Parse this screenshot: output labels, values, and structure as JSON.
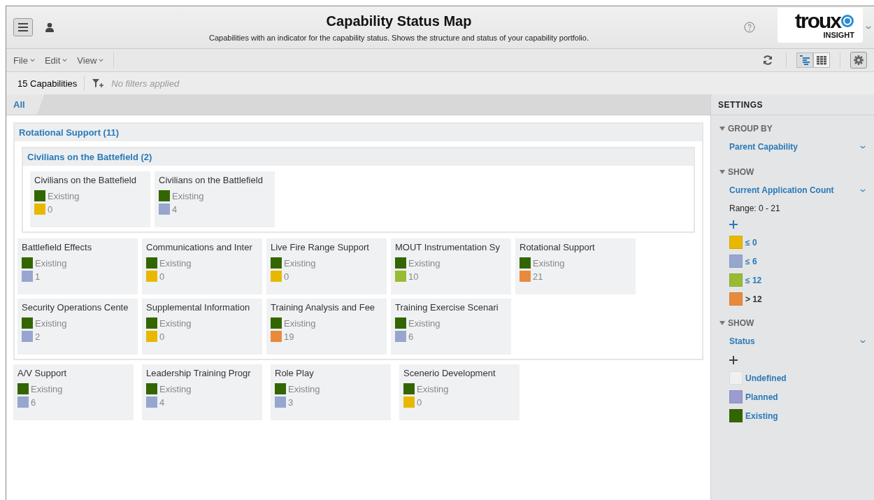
{
  "header": {
    "title": "Capability Status Map",
    "subtitle": "Capabilities with an indicator for the capability status. Shows the structure and status of your capability portfolio.",
    "logo": "troux",
    "logo_sub": "INSIGHT"
  },
  "menus": [
    {
      "label": "File"
    },
    {
      "label": "Edit"
    },
    {
      "label": "View"
    }
  ],
  "view_toggles": [
    {
      "kind": "tree",
      "selected": true
    },
    {
      "kind": "grid",
      "selected": false
    }
  ],
  "filter_bar": {
    "count": "15 Capabilities",
    "filters": "No filters applied"
  },
  "tabs": [
    {
      "label": "All",
      "selected": true
    }
  ],
  "groups": [
    {
      "title": "Rotational Support (11)",
      "subgroups": [
        {
          "title": "Civilians on the Battefield  (2)",
          "cards": [
            {
              "name": "Civilians on the Battefield",
              "status": {
                "label": "Existing",
                "color": "#336600"
              },
              "count": {
                "value": "0",
                "color": "#e8b800"
              }
            },
            {
              "name": "Civilians on the Battlefield",
              "status": {
                "label": "Existing",
                "color": "#336600"
              },
              "count": {
                "value": "4",
                "color": "#97a6cf"
              }
            }
          ]
        }
      ],
      "cards": [
        {
          "name": "Battlefield Effects",
          "status": {
            "label": "Existing",
            "color": "#336600"
          },
          "count": {
            "value": "1",
            "color": "#97a6cf"
          }
        },
        {
          "name": "Communications and Inter",
          "status": {
            "label": "Existing",
            "color": "#336600"
          },
          "count": {
            "value": "0",
            "color": "#e8b800"
          }
        },
        {
          "name": "Live Fire Range Support",
          "status": {
            "label": "Existing",
            "color": "#336600"
          },
          "count": {
            "value": "0",
            "color": "#e8b800"
          }
        },
        {
          "name": "MOUT Instrumentation Sy",
          "status": {
            "label": "Existing",
            "color": "#336600"
          },
          "count": {
            "value": "10",
            "color": "#99bb33"
          }
        },
        {
          "name": "Rotational Support",
          "status": {
            "label": "Existing",
            "color": "#336600"
          },
          "count": {
            "value": "21",
            "color": "#e88a3c"
          }
        },
        {
          "name": "Security Operations Cente",
          "status": {
            "label": "Existing",
            "color": "#336600"
          },
          "count": {
            "value": "2",
            "color": "#97a6cf"
          }
        },
        {
          "name": "Supplemental Information",
          "status": {
            "label": "Existing",
            "color": "#336600"
          },
          "count": {
            "value": "0",
            "color": "#e8b800"
          }
        },
        {
          "name": "Training Analysis and Fee",
          "status": {
            "label": "Existing",
            "color": "#336600"
          },
          "count": {
            "value": "19",
            "color": "#e88a3c"
          }
        },
        {
          "name": "Training Exercise Scenari",
          "status": {
            "label": "Existing",
            "color": "#336600"
          },
          "count": {
            "value": "6",
            "color": "#97a6cf"
          }
        }
      ]
    }
  ],
  "cards": [
    {
      "name": "A/V Support",
      "status": {
        "label": "Existing",
        "color": "#336600"
      },
      "count": {
        "value": "6",
        "color": "#97a6cf"
      }
    },
    {
      "name": "Leadership Training Progr",
      "status": {
        "label": "Existing",
        "color": "#336600"
      },
      "count": {
        "value": "4",
        "color": "#97a6cf"
      }
    },
    {
      "name": "Role Play",
      "status": {
        "label": "Existing",
        "color": "#336600"
      },
      "count": {
        "value": "3",
        "color": "#97a6cf"
      }
    },
    {
      "name": "Scenerio Development",
      "status": {
        "label": "Existing",
        "color": "#336600"
      },
      "count": {
        "value": "0",
        "color": "#e8b800"
      }
    }
  ],
  "settings": {
    "title": "SETTINGS",
    "sections": [
      {
        "heading": "GROUP BY",
        "select": "Parent Capability"
      },
      {
        "heading": "SHOW",
        "select": "Current Application Count",
        "range": "Range:  0  -  21",
        "add_active": true,
        "legend": [
          {
            "label": "≤ 0",
            "color": "#e8b800",
            "muted": false
          },
          {
            "label": "≤ 6",
            "color": "#97a6cf",
            "muted": false
          },
          {
            "label": "≤ 12",
            "color": "#99bb33",
            "muted": false
          },
          {
            "label": "> 12",
            "color": "#e88a3c",
            "muted": true
          }
        ]
      },
      {
        "heading": "SHOW",
        "select": "Status",
        "add_active": false,
        "legend": [
          {
            "label": "Undefined",
            "color": "#f0f0f0",
            "muted": false
          },
          {
            "label": "Planned",
            "color": "#9b9bd0",
            "muted": false
          },
          {
            "label": "Existing",
            "color": "#336600",
            "muted": false
          }
        ]
      }
    ]
  }
}
